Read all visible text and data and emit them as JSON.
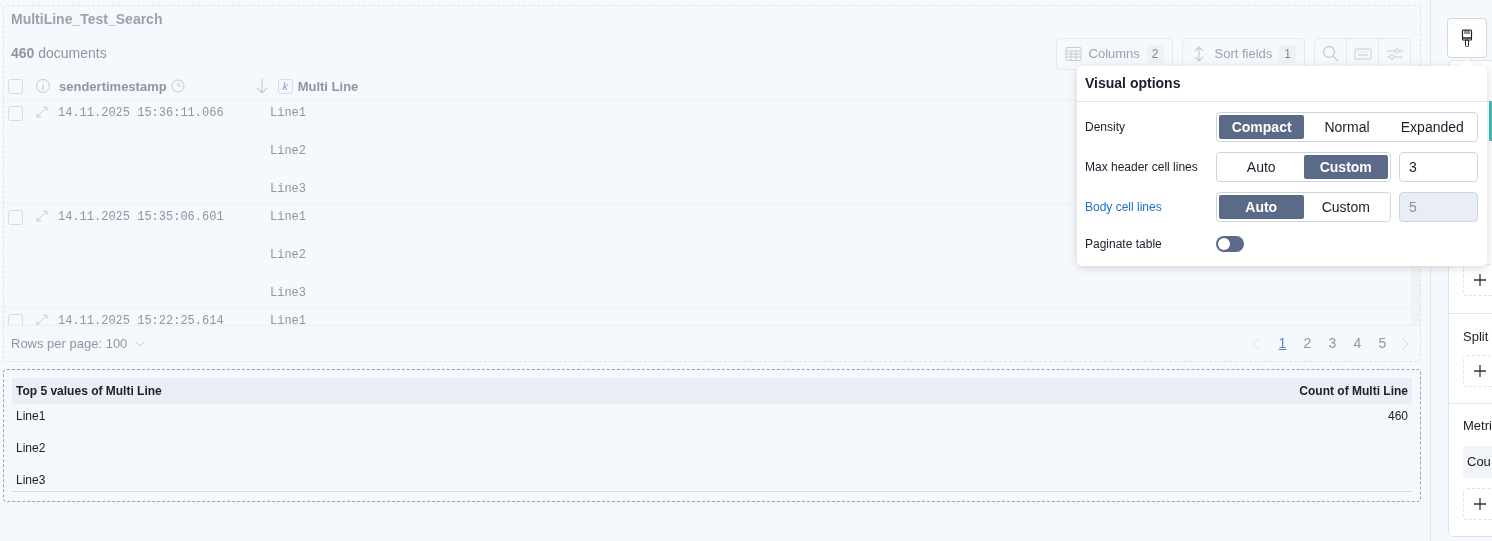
{
  "panel": {
    "title": "MultiLine_Test_Search",
    "count": "460",
    "count_label": "documents",
    "toolbar": [
      {
        "kind": "columns",
        "label": "Columns",
        "badge": "2"
      },
      {
        "kind": "sort",
        "label": "Sort fields",
        "badge": "1"
      }
    ],
    "table": {
      "select_all_checked": false,
      "columns": [
        {
          "label": "sendertimestamp"
        },
        {
          "label": "Multi Line",
          "type_badge": "k"
        }
      ],
      "rows": [
        {
          "checked": false,
          "timestamp": "14.11.2025 15:36:11.066",
          "lines": [
            "Line1",
            "Line2",
            "Line3"
          ]
        },
        {
          "checked": false,
          "timestamp": "14.11.2025 15:35:06.601",
          "lines": [
            "Line1",
            "Line2",
            "Line3"
          ]
        },
        {
          "checked": false,
          "timestamp": "14.11.2025 15:22:25.614",
          "lines": [
            "Line1"
          ]
        }
      ]
    },
    "footer": {
      "rows_per_page": "Rows per page: 100",
      "pages": [
        {
          "label": "1",
          "selected": true
        },
        {
          "label": "2",
          "selected": false
        },
        {
          "label": "3",
          "selected": false
        },
        {
          "label": "4",
          "selected": false
        },
        {
          "label": "5",
          "selected": false
        }
      ]
    }
  },
  "top_values": {
    "columns": [
      "Top 5 values of Multi Line",
      "Count of Multi Line"
    ],
    "rows": [
      {
        "value": "Line1",
        "count": "460"
      },
      {
        "value": "Line2"
      },
      {
        "value": "Line3"
      }
    ]
  },
  "sidebar": {
    "sections": [
      {
        "title": "Split"
      },
      {
        "title": "Metri",
        "items": [
          "Cou"
        ]
      }
    ]
  },
  "popover": {
    "title": "Visual options",
    "rows": [
      {
        "kind": "segmented",
        "label": "Density",
        "highlighted": false,
        "options": [
          {
            "label": "Compact",
            "selected": true
          },
          {
            "label": "Normal",
            "selected": false
          },
          {
            "label": "Expanded",
            "selected": false
          }
        ]
      },
      {
        "kind": "segmented_input",
        "label": "Max header cell lines",
        "highlighted": false,
        "options": [
          {
            "label": "Auto",
            "selected": false
          },
          {
            "label": "Custom",
            "selected": true
          }
        ],
        "value": "3",
        "disabled": false
      },
      {
        "kind": "segmented_input",
        "label": "Body cell lines",
        "highlighted": true,
        "options": [
          {
            "label": "Auto",
            "selected": true
          },
          {
            "label": "Custom",
            "selected": false
          }
        ],
        "value": "5",
        "disabled": true
      },
      {
        "kind": "toggle",
        "label": "Paginate table",
        "highlighted": false,
        "on": false
      }
    ]
  }
}
